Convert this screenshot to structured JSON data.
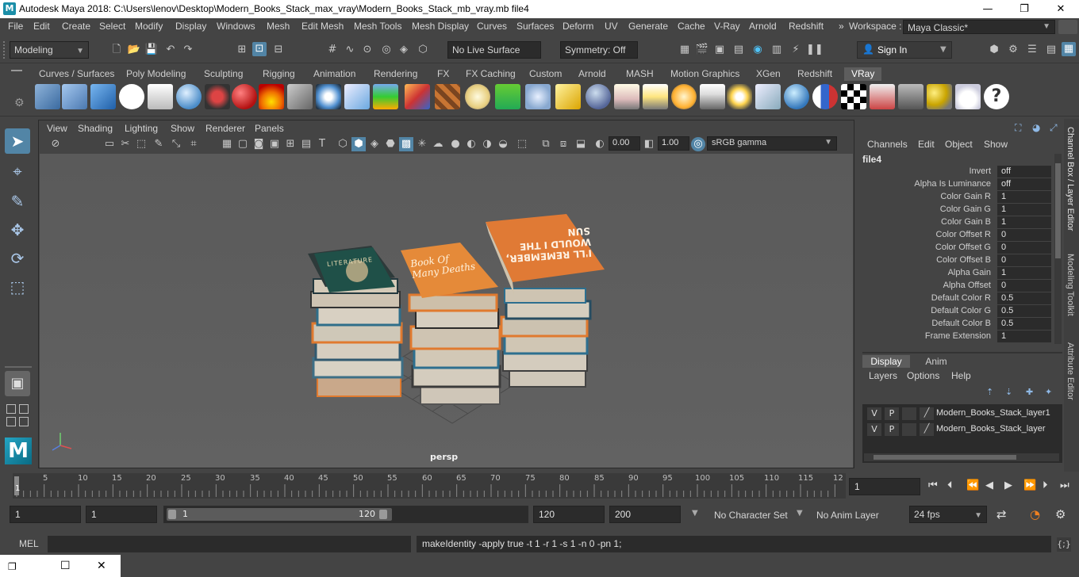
{
  "title_bar": {
    "title": "Autodesk Maya 2018: C:\\Users\\lenov\\Desktop\\Modern_Books_Stack_max_vray\\Modern_Books_Stack_mb_vray.mb     file4",
    "minimize": "—",
    "maximize": "❐",
    "close": "✕"
  },
  "menu_bar": {
    "items": [
      "File",
      "Edit",
      "Create",
      "Select",
      "Modify",
      "Display",
      "Windows",
      "Mesh",
      "Edit Mesh",
      "Mesh Tools",
      "Mesh Display",
      "Curves",
      "Surfaces",
      "Deform",
      "UV",
      "Generate",
      "Cache",
      "V-Ray",
      "Arnold",
      "Redshift"
    ],
    "overflow": "»",
    "workspace_label": "Workspace :",
    "workspace_value": "Maya Classic*"
  },
  "status_line": {
    "mode": "Modeling",
    "live_surface": "No Live Surface",
    "symmetry": "Symmetry: Off",
    "sign_in": "Sign In"
  },
  "shelf_tabs": {
    "items": [
      "Curves / Surfaces",
      "Poly Modeling",
      "Sculpting",
      "Rigging",
      "Animation",
      "Rendering",
      "FX",
      "FX Caching",
      "Custom",
      "Arnold",
      "MASH",
      "Motion Graphics",
      "XGen",
      "Redshift",
      "VRay"
    ],
    "active": "VRay"
  },
  "viewport": {
    "menu": [
      "View",
      "Shading",
      "Lighting",
      "Show",
      "Renderer",
      "Panels"
    ],
    "exposure": "0.00",
    "gamma": "1.00",
    "color_space": "sRGB gamma",
    "camera_label": "persp",
    "book_cover_1": "LITERATURE",
    "book_cover_2": "Book Of Many Deaths",
    "book_cover_3": "I'LL REMEMBER, WOULD I THE SUN"
  },
  "channel_box": {
    "menu": [
      "Channels",
      "Edit",
      "Object",
      "Show"
    ],
    "node_name": "file4",
    "attributes": [
      {
        "label": "Invert",
        "value": "off"
      },
      {
        "label": "Alpha Is Luminance",
        "value": "off"
      },
      {
        "label": "Color Gain R",
        "value": "1"
      },
      {
        "label": "Color Gain G",
        "value": "1"
      },
      {
        "label": "Color Gain B",
        "value": "1"
      },
      {
        "label": "Color Offset R",
        "value": "0"
      },
      {
        "label": "Color Offset G",
        "value": "0"
      },
      {
        "label": "Color Offset B",
        "value": "0"
      },
      {
        "label": "Alpha Gain",
        "value": "1"
      },
      {
        "label": "Alpha Offset",
        "value": "0"
      },
      {
        "label": "Default Color R",
        "value": "0.5"
      },
      {
        "label": "Default Color G",
        "value": "0.5"
      },
      {
        "label": "Default Color B",
        "value": "0.5"
      },
      {
        "label": "Frame Extension",
        "value": "1"
      }
    ]
  },
  "layer_editor": {
    "tabs": [
      "Display",
      "Anim"
    ],
    "active_tab": "Display",
    "menu": [
      "Layers",
      "Options",
      "Help"
    ],
    "layers": [
      {
        "v": "V",
        "p": "P",
        "name": "Modern_Books_Stack_layer1"
      },
      {
        "v": "V",
        "p": "P",
        "name": "Modern_Books_Stack_layer"
      }
    ]
  },
  "side_tabs": [
    "Channel Box / Layer Editor",
    "Modeling Toolkit",
    "Attribute Editor"
  ],
  "time_slider": {
    "ticks": [
      "5",
      "10",
      "15",
      "20",
      "25",
      "30",
      "35",
      "40",
      "45",
      "50",
      "55",
      "60",
      "65",
      "70",
      "75",
      "80",
      "85",
      "90",
      "95",
      "100",
      "105",
      "110",
      "115",
      "12"
    ],
    "current_frame_marker": "1",
    "current_frame": "1"
  },
  "range_slider": {
    "start": "1",
    "playback_start": "1",
    "range_start": "1",
    "range_end": "120",
    "playback_end": "120",
    "end": "200",
    "character_set": "No Character Set",
    "anim_layer": "No Anim Layer",
    "fps": "24 fps"
  },
  "command_line": {
    "language": "MEL",
    "result": "makeIdentity -apply true -t 1 -r 1 -s 1 -n 0 -pn 1;"
  },
  "colors": {
    "accent_blue": "#5285a6",
    "panel_bg": "#444444",
    "field_bg": "#2b2b2b"
  }
}
